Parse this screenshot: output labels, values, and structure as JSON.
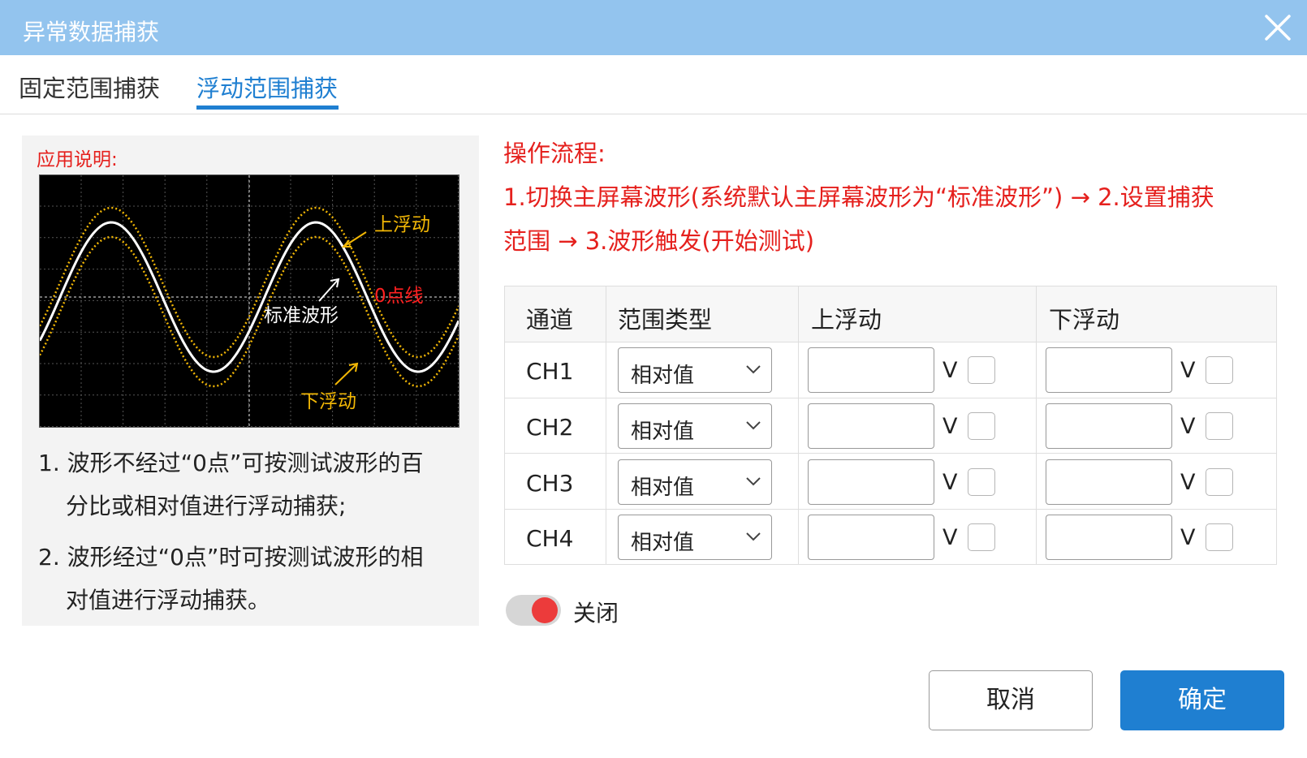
{
  "window": {
    "title": "异常数据捕获",
    "close_icon": "close-icon"
  },
  "tabs": [
    {
      "label": "固定范围捕获",
      "active": false
    },
    {
      "label": "浮动范围捕获",
      "active": true
    }
  ],
  "help": {
    "title": "应用说明:",
    "figure": {
      "upper_label": "上浮动",
      "lower_label": "下浮动",
      "zero_label": "0点线",
      "standard_label": "标准波形"
    },
    "lines": [
      "1. 波形不经过“0点”可按测试波形的百",
      "分比或相对值进行浮动捕获;",
      "2. 波形经过“0点”时可按测试波形的相",
      "对值进行浮动捕获。"
    ]
  },
  "flow": {
    "title": "操作流程:",
    "line1": "1.切换主屏幕波形(系统默认主屏幕波形为“标准波形”) → 2.设置捕获",
    "line2": "范围 → 3.波形触发(开始测试)"
  },
  "table": {
    "headers": [
      "通道",
      "范围类型",
      "上浮动",
      "下浮动"
    ],
    "rows": [
      {
        "channel": "CH1",
        "type": "相对值",
        "upper": "",
        "upper_unit": "V",
        "upper_checked": false,
        "lower": "",
        "lower_unit": "V",
        "lower_checked": false
      },
      {
        "channel": "CH2",
        "type": "相对值",
        "upper": "",
        "upper_unit": "V",
        "upper_checked": false,
        "lower": "",
        "lower_unit": "V",
        "lower_checked": false
      },
      {
        "channel": "CH3",
        "type": "相对值",
        "upper": "",
        "upper_unit": "V",
        "upper_checked": false,
        "lower": "",
        "lower_unit": "V",
        "lower_checked": false
      },
      {
        "channel": "CH4",
        "type": "相对值",
        "upper": "",
        "upper_unit": "V",
        "upper_checked": false,
        "lower": "",
        "lower_unit": "V",
        "lower_checked": false
      }
    ]
  },
  "toggle": {
    "label": "关闭",
    "on": false
  },
  "buttons": {
    "cancel": "取消",
    "ok": "确定"
  },
  "colors": {
    "titlebar": "#93c4ee",
    "accent": "#1f7fd1",
    "warning_text": "#e5201d",
    "toggle_knob": "#ec3b3b",
    "wave_upper_lower": "#f2b705"
  }
}
